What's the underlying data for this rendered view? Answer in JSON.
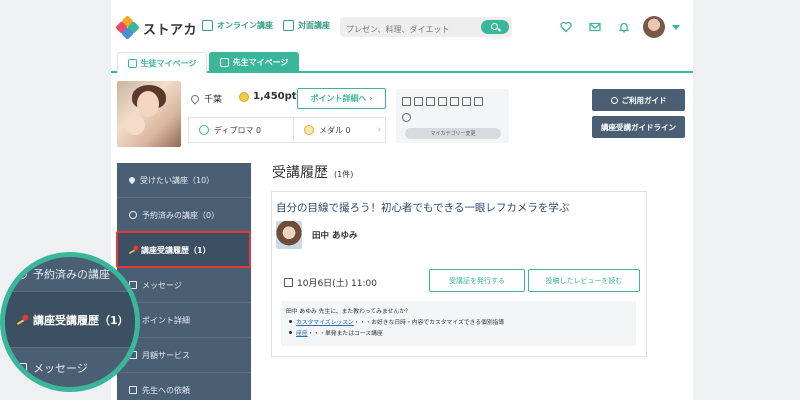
{
  "header": {
    "brand": "ストアカ",
    "nav_online": "オンライン講座",
    "nav_inperson": "対面講座",
    "search_placeholder": "プレゼン、料理、ダイエット"
  },
  "tabs": [
    {
      "label": "生徒マイページ"
    },
    {
      "label": "先生マイページ"
    }
  ],
  "profile": {
    "location": "千葉",
    "points": "1,450pt",
    "points_button": "ポイント詳細へ ›",
    "diploma": "ディプロマ 0",
    "medal": "メダル 0",
    "category_button": "マイカテゴリー変更"
  },
  "guides": {
    "usage": "ご利用ガイド",
    "guideline": "講座受講ガイドライン"
  },
  "sidebar": {
    "items": [
      {
        "label": "受けたい講座（10）"
      },
      {
        "label": "予約済みの講座（0）"
      },
      {
        "label": "講座受講履歴（1）"
      },
      {
        "label": "メッセージ"
      },
      {
        "label": "ポイント詳細"
      },
      {
        "label": "月額サービス"
      },
      {
        "label": "先生への依頼"
      }
    ]
  },
  "main": {
    "title": "受講履歴",
    "count": "(1件)",
    "course": {
      "title": "自分の目線で撮ろう！初心者でもできる一眼レフカメラを学ぶ",
      "teacher": "田中 あゆみ",
      "date": "10月6日(土) 11:00",
      "btn_certificate": "受講証を発行する",
      "btn_reviews": "投稿したレビューを読む",
      "info_intro": "田中 あゆみ 先生に、また教わってみませんか？",
      "info_link1": "カスタマイズレッスン",
      "info_text1": "・・・お好きな日時・内容でカスタマイズできる個別指導",
      "info_link2": "座座",
      "info_text2": "・・・単発またはコース講座"
    }
  },
  "zoom": {
    "item1": "予約済みの講座",
    "item2": "講座受講履歴（1）",
    "item3": "メッセージ"
  },
  "colors": {
    "accent": "#3ab69a",
    "sidebar": "#4a5f74",
    "highlight": "#e53935"
  }
}
